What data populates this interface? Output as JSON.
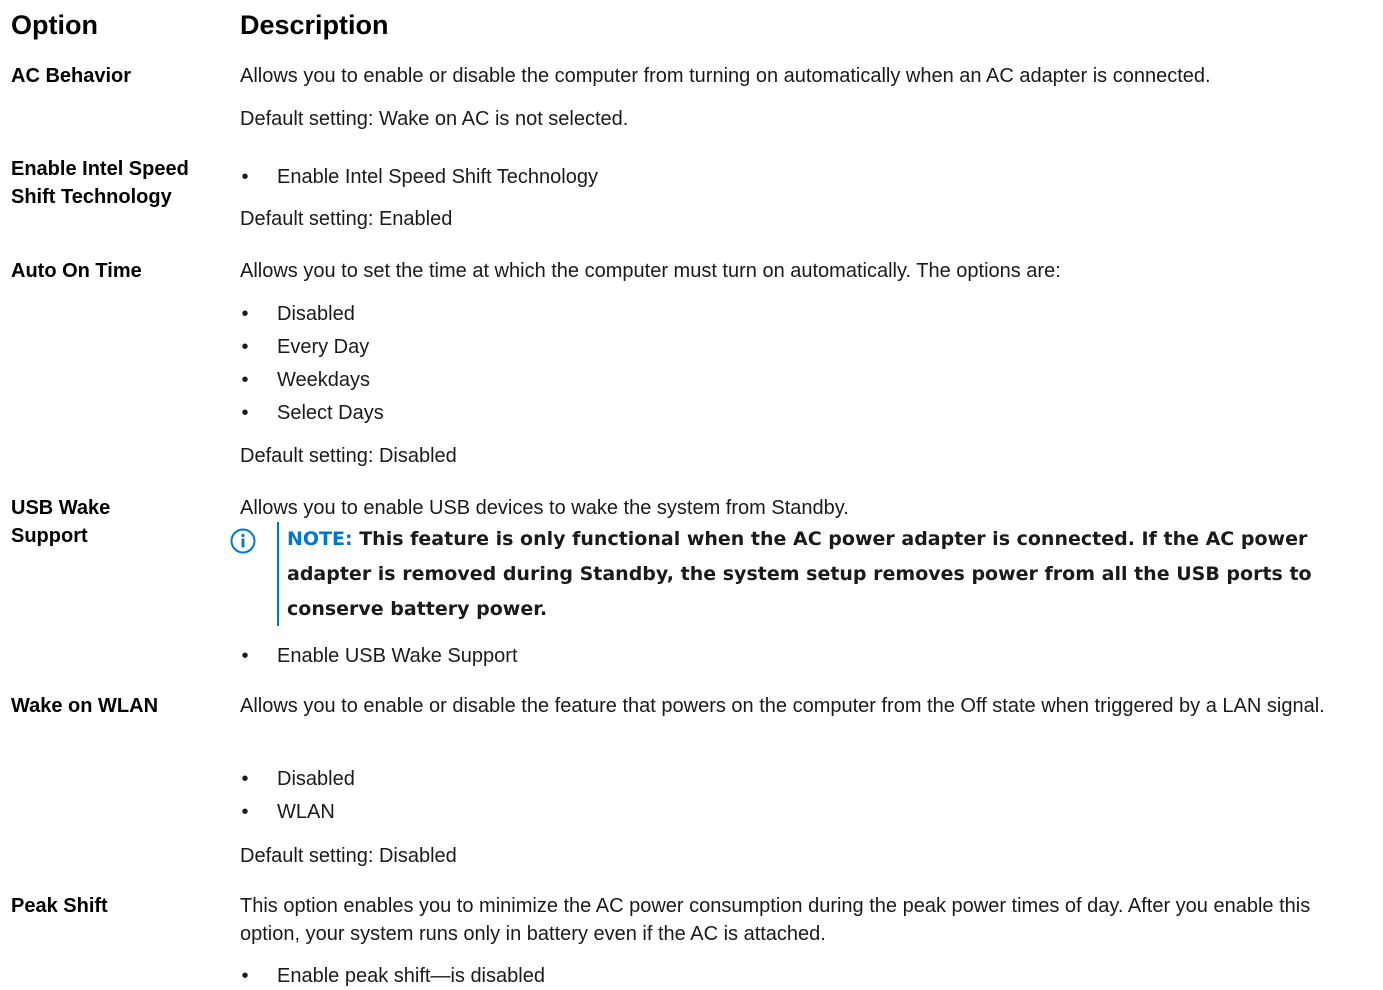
{
  "header": {
    "option": "Option",
    "description": "Description"
  },
  "rows": [
    {
      "name": "AC Behavior",
      "text": "Allows you to enable or disable the computer from turning on automatically when an AC adapter is connected.",
      "default": "Default setting: Wake on AC is not selected."
    },
    {
      "name": "Enable Intel Speed Shift Technology",
      "bullets": [
        "Enable Intel Speed Shift Technology"
      ],
      "default": "Default setting: Enabled"
    },
    {
      "name": "Auto On Time",
      "text": "Allows you to set the time at which the computer must turn on automatically. The options are:",
      "bullets": [
        "Disabled",
        "Every Day",
        "Weekdays",
        "Select Days"
      ],
      "default": "Default setting: Disabled"
    },
    {
      "name": "USB Wake Support",
      "text": "Allows you to enable USB devices to wake the system from Standby.",
      "note_label": "NOTE:",
      "note": "This feature is only functional when the AC power adapter is connected. If the AC power adapter is removed during Standby, the system setup removes power from all the USB ports to conserve battery power.",
      "bullets": [
        "Enable USB Wake Support"
      ]
    },
    {
      "name": "Wake on WLAN",
      "text": "Allows you to enable or disable the feature that powers on the computer from the Off state when triggered by a LAN signal.",
      "bullets": [
        "Disabled",
        "WLAN"
      ],
      "default": "Default setting: Disabled"
    },
    {
      "name": "Peak Shift",
      "text": "This option enables you to minimize the AC power consumption during the peak power times of day. After you enable this option, your system runs only in battery even if the AC is attached.",
      "bullets": [
        "Enable peak shift—is disabled"
      ]
    }
  ],
  "bullet_char": "•",
  "colors": {
    "note_accent": "#0076ce",
    "text": "#1a1a1a"
  },
  "icons": {
    "note": "info-circle-icon"
  }
}
